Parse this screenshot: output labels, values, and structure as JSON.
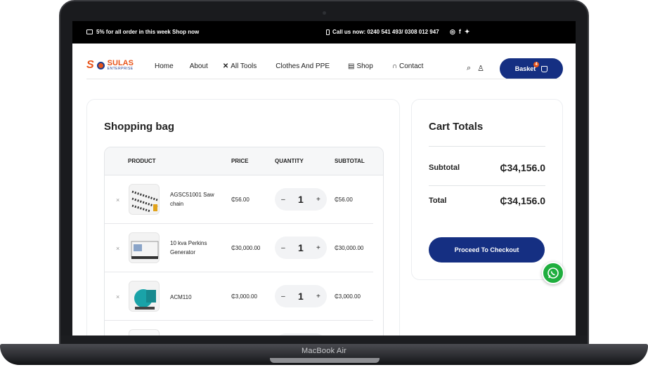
{
  "topbar": {
    "promo": "5% for all order in this week Shop now",
    "call": "Call us now: 0240 541 493/ 0308 012 947"
  },
  "logo": {
    "mark": "S",
    "name": "SULAS",
    "sub": "ENTERPRISE"
  },
  "nav": {
    "items": [
      {
        "label": "Home"
      },
      {
        "label": "About"
      },
      {
        "label": "All Tools",
        "icon": "tools-icon"
      },
      {
        "label": "Clothes And PPE"
      },
      {
        "label": "Shop",
        "icon": "store-icon"
      },
      {
        "label": "Contact",
        "icon": "headset-icon"
      }
    ],
    "basket_label": "Basket",
    "basket_count": "4"
  },
  "bag": {
    "title": "Shopping bag",
    "headers": {
      "product": "PRODUCT",
      "price": "PRICE",
      "quantity": "QUANTITY",
      "subtotal": "SUBTOTAL"
    },
    "rows": [
      {
        "name": "AGSC51001 Saw chain",
        "price": "₵56.00",
        "qty": "1",
        "subtotal": "₵56.00"
      },
      {
        "name": "10 kva Perkins Generator",
        "price": "₵30,000.00",
        "qty": "1",
        "subtotal": "₵30,000.00"
      },
      {
        "name": "ACM110",
        "price": "₵3,000.00",
        "qty": "1",
        "subtotal": "₵3,000.00"
      }
    ]
  },
  "totals": {
    "title": "Cart Totals",
    "subtotal_label": "Subtotal",
    "subtotal_value": "₵34,156.0",
    "total_label": "Total",
    "total_value": "₵34,156.0",
    "checkout_label": "Proceed To Checkout"
  },
  "device": {
    "model": "MacBook Air"
  },
  "colors": {
    "primary": "#152f82",
    "accent": "#e8541a",
    "whatsapp": "#1fae3e"
  }
}
